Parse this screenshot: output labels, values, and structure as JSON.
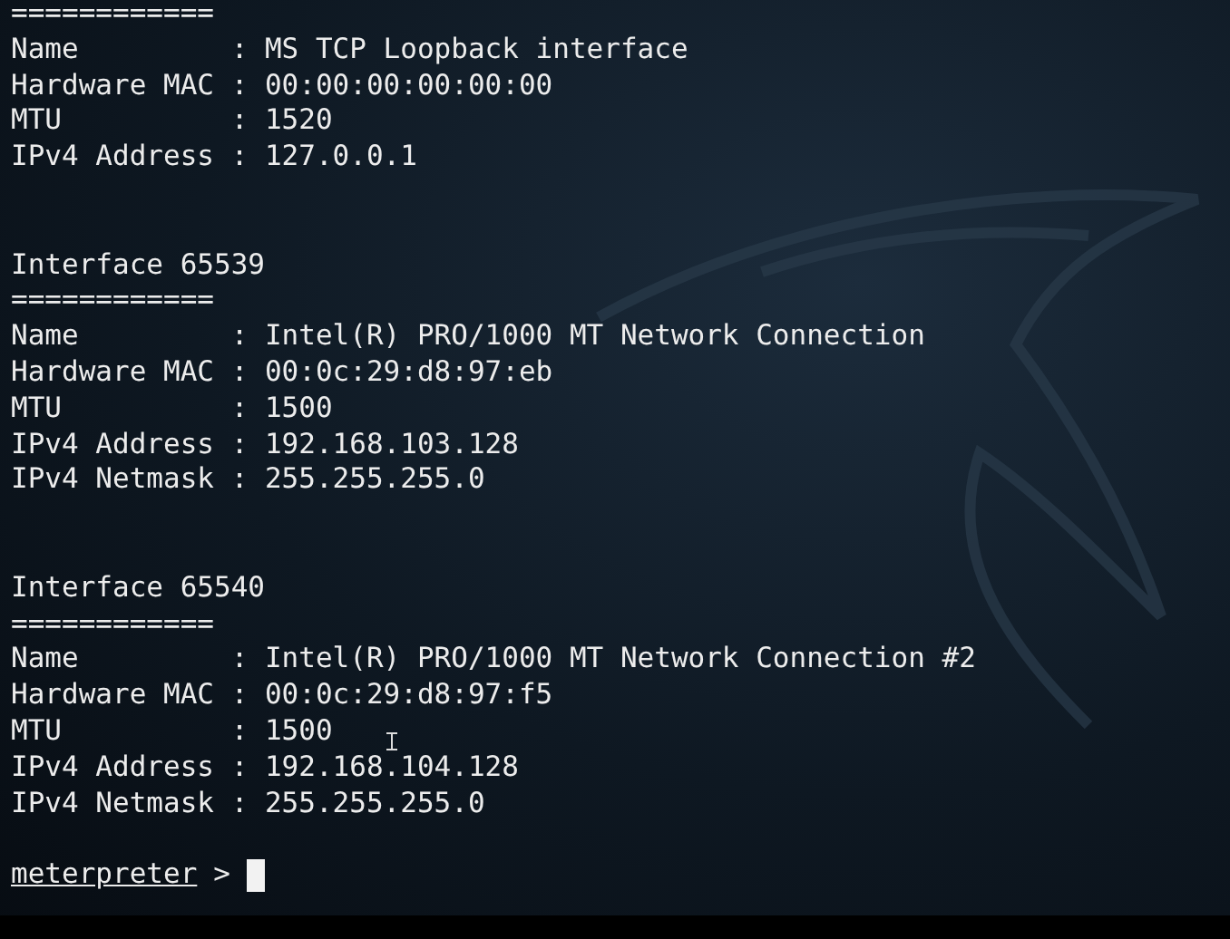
{
  "terminal": {
    "lines": [
      {
        "kind": "separator",
        "text": "============"
      },
      {
        "kind": "field",
        "label": "Name",
        "value": ": MS TCP Loopback interface"
      },
      {
        "kind": "field",
        "label": "Hardware MAC",
        "value": ": 00:00:00:00:00:00"
      },
      {
        "kind": "field",
        "label": "MTU",
        "value": ": 1520"
      },
      {
        "kind": "field",
        "label": "IPv4 Address",
        "value": ": 127.0.0.1"
      },
      {
        "kind": "blank"
      },
      {
        "kind": "blank"
      },
      {
        "kind": "heading",
        "text": "Interface 65539"
      },
      {
        "kind": "separator",
        "text": "============"
      },
      {
        "kind": "field",
        "label": "Name",
        "value": ": Intel(R) PRO/1000 MT Network Connection"
      },
      {
        "kind": "field",
        "label": "Hardware MAC",
        "value": ": 00:0c:29:d8:97:eb"
      },
      {
        "kind": "field",
        "label": "MTU",
        "value": ": 1500"
      },
      {
        "kind": "field",
        "label": "IPv4 Address",
        "value": ": 192.168.103.128"
      },
      {
        "kind": "field",
        "label": "IPv4 Netmask",
        "value": ": 255.255.255.0"
      },
      {
        "kind": "blank"
      },
      {
        "kind": "blank"
      },
      {
        "kind": "heading",
        "text": "Interface 65540"
      },
      {
        "kind": "separator",
        "text": "============"
      },
      {
        "kind": "field",
        "label": "Name",
        "value": ": Intel(R) PRO/1000 MT Network Connection #2"
      },
      {
        "kind": "field",
        "label": "Hardware MAC",
        "value": ": 00:0c:29:d8:97:f5"
      },
      {
        "kind": "field",
        "label": "MTU",
        "value": ": 1500"
      },
      {
        "kind": "field",
        "label": "IPv4 Address",
        "value": ": 192.168.104.128"
      },
      {
        "kind": "field",
        "label": "IPv4 Netmask",
        "value": ": 255.255.255.0"
      },
      {
        "kind": "blank"
      },
      {
        "kind": "prompt",
        "text": "meterpreter",
        "symbol": ">"
      }
    ]
  }
}
